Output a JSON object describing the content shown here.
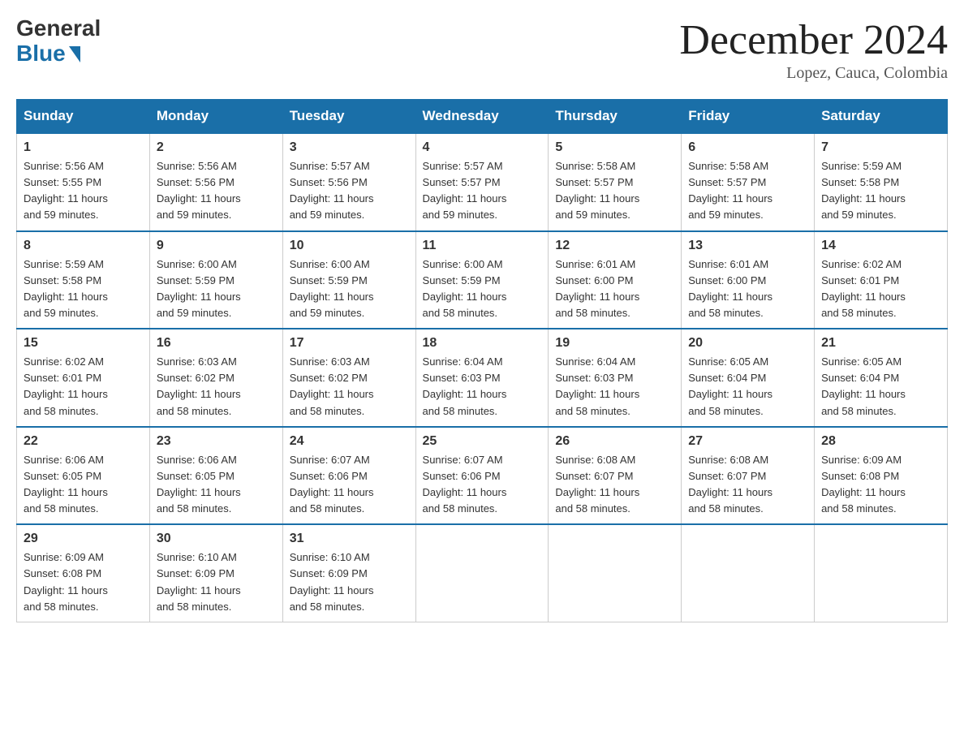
{
  "header": {
    "logo_general": "General",
    "logo_blue": "Blue",
    "month_title": "December 2024",
    "location": "Lopez, Cauca, Colombia"
  },
  "weekdays": [
    "Sunday",
    "Monday",
    "Tuesday",
    "Wednesday",
    "Thursday",
    "Friday",
    "Saturday"
  ],
  "weeks": [
    [
      {
        "day": "1",
        "sunrise": "5:56 AM",
        "sunset": "5:55 PM",
        "daylight": "11 hours and 59 minutes."
      },
      {
        "day": "2",
        "sunrise": "5:56 AM",
        "sunset": "5:56 PM",
        "daylight": "11 hours and 59 minutes."
      },
      {
        "day": "3",
        "sunrise": "5:57 AM",
        "sunset": "5:56 PM",
        "daylight": "11 hours and 59 minutes."
      },
      {
        "day": "4",
        "sunrise": "5:57 AM",
        "sunset": "5:57 PM",
        "daylight": "11 hours and 59 minutes."
      },
      {
        "day": "5",
        "sunrise": "5:58 AM",
        "sunset": "5:57 PM",
        "daylight": "11 hours and 59 minutes."
      },
      {
        "day": "6",
        "sunrise": "5:58 AM",
        "sunset": "5:57 PM",
        "daylight": "11 hours and 59 minutes."
      },
      {
        "day": "7",
        "sunrise": "5:59 AM",
        "sunset": "5:58 PM",
        "daylight": "11 hours and 59 minutes."
      }
    ],
    [
      {
        "day": "8",
        "sunrise": "5:59 AM",
        "sunset": "5:58 PM",
        "daylight": "11 hours and 59 minutes."
      },
      {
        "day": "9",
        "sunrise": "6:00 AM",
        "sunset": "5:59 PM",
        "daylight": "11 hours and 59 minutes."
      },
      {
        "day": "10",
        "sunrise": "6:00 AM",
        "sunset": "5:59 PM",
        "daylight": "11 hours and 59 minutes."
      },
      {
        "day": "11",
        "sunrise": "6:00 AM",
        "sunset": "5:59 PM",
        "daylight": "11 hours and 58 minutes."
      },
      {
        "day": "12",
        "sunrise": "6:01 AM",
        "sunset": "6:00 PM",
        "daylight": "11 hours and 58 minutes."
      },
      {
        "day": "13",
        "sunrise": "6:01 AM",
        "sunset": "6:00 PM",
        "daylight": "11 hours and 58 minutes."
      },
      {
        "day": "14",
        "sunrise": "6:02 AM",
        "sunset": "6:01 PM",
        "daylight": "11 hours and 58 minutes."
      }
    ],
    [
      {
        "day": "15",
        "sunrise": "6:02 AM",
        "sunset": "6:01 PM",
        "daylight": "11 hours and 58 minutes."
      },
      {
        "day": "16",
        "sunrise": "6:03 AM",
        "sunset": "6:02 PM",
        "daylight": "11 hours and 58 minutes."
      },
      {
        "day": "17",
        "sunrise": "6:03 AM",
        "sunset": "6:02 PM",
        "daylight": "11 hours and 58 minutes."
      },
      {
        "day": "18",
        "sunrise": "6:04 AM",
        "sunset": "6:03 PM",
        "daylight": "11 hours and 58 minutes."
      },
      {
        "day": "19",
        "sunrise": "6:04 AM",
        "sunset": "6:03 PM",
        "daylight": "11 hours and 58 minutes."
      },
      {
        "day": "20",
        "sunrise": "6:05 AM",
        "sunset": "6:04 PM",
        "daylight": "11 hours and 58 minutes."
      },
      {
        "day": "21",
        "sunrise": "6:05 AM",
        "sunset": "6:04 PM",
        "daylight": "11 hours and 58 minutes."
      }
    ],
    [
      {
        "day": "22",
        "sunrise": "6:06 AM",
        "sunset": "6:05 PM",
        "daylight": "11 hours and 58 minutes."
      },
      {
        "day": "23",
        "sunrise": "6:06 AM",
        "sunset": "6:05 PM",
        "daylight": "11 hours and 58 minutes."
      },
      {
        "day": "24",
        "sunrise": "6:07 AM",
        "sunset": "6:06 PM",
        "daylight": "11 hours and 58 minutes."
      },
      {
        "day": "25",
        "sunrise": "6:07 AM",
        "sunset": "6:06 PM",
        "daylight": "11 hours and 58 minutes."
      },
      {
        "day": "26",
        "sunrise": "6:08 AM",
        "sunset": "6:07 PM",
        "daylight": "11 hours and 58 minutes."
      },
      {
        "day": "27",
        "sunrise": "6:08 AM",
        "sunset": "6:07 PM",
        "daylight": "11 hours and 58 minutes."
      },
      {
        "day": "28",
        "sunrise": "6:09 AM",
        "sunset": "6:08 PM",
        "daylight": "11 hours and 58 minutes."
      }
    ],
    [
      {
        "day": "29",
        "sunrise": "6:09 AM",
        "sunset": "6:08 PM",
        "daylight": "11 hours and 58 minutes."
      },
      {
        "day": "30",
        "sunrise": "6:10 AM",
        "sunset": "6:09 PM",
        "daylight": "11 hours and 58 minutes."
      },
      {
        "day": "31",
        "sunrise": "6:10 AM",
        "sunset": "6:09 PM",
        "daylight": "11 hours and 58 minutes."
      },
      null,
      null,
      null,
      null
    ]
  ],
  "labels": {
    "sunrise": "Sunrise:",
    "sunset": "Sunset:",
    "daylight": "Daylight:"
  }
}
